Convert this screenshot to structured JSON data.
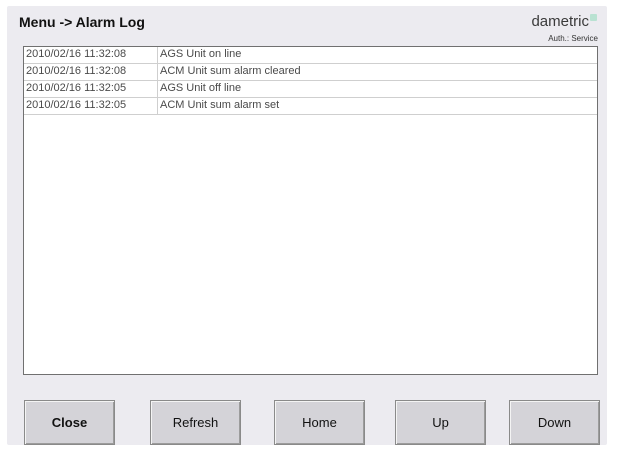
{
  "header": {
    "title": "Menu -> Alarm Log",
    "brand": "dametric",
    "auth": "Auth.: Service"
  },
  "colors": {
    "panel_bg": "#ecebf0",
    "button_bg": "#d4d3d8",
    "brand_mark": "#b9e2d2"
  },
  "log": {
    "rows": [
      {
        "time": "2010/02/16 11:32:08",
        "message": "AGS Unit on line"
      },
      {
        "time": "2010/02/16 11:32:08",
        "message": "ACM Unit sum alarm cleared"
      },
      {
        "time": "2010/02/16 11:32:05",
        "message": "AGS Unit off line"
      },
      {
        "time": "2010/02/16 11:32:05",
        "message": "ACM Unit sum alarm set"
      }
    ]
  },
  "buttons": {
    "close": "Close",
    "refresh": "Refresh",
    "home": "Home",
    "up": "Up",
    "down": "Down"
  }
}
